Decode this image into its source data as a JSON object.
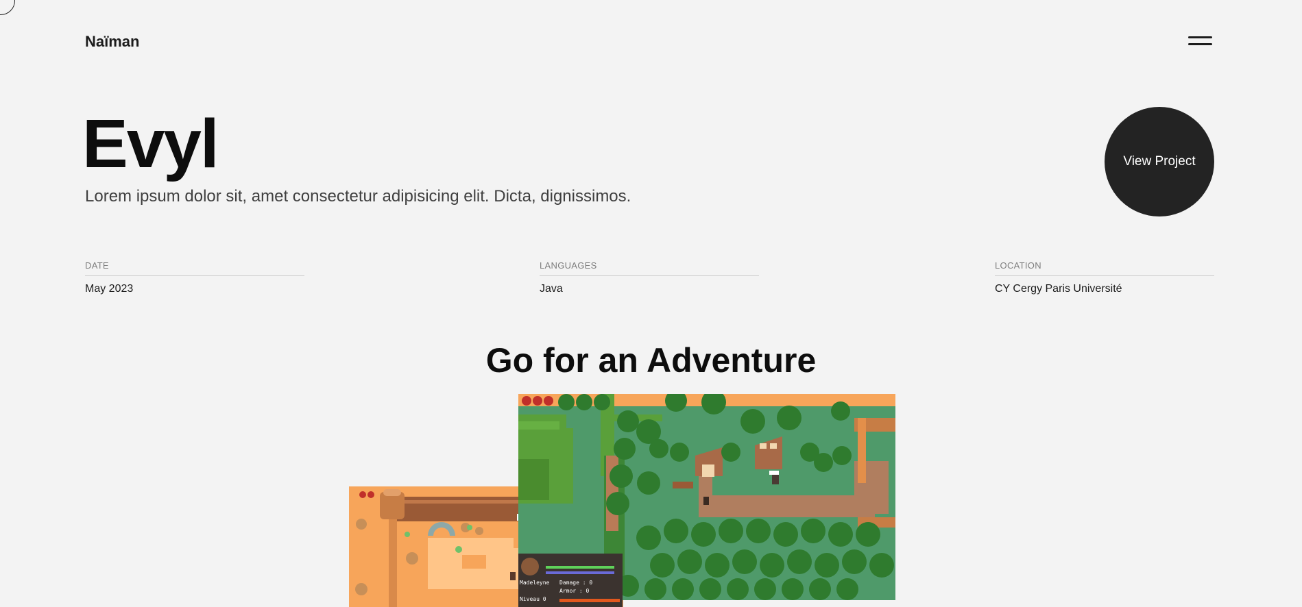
{
  "header": {
    "brand": "Naïman",
    "menu_icon": "hamburger-icon"
  },
  "hero": {
    "title": "Evyl",
    "subtitle": "Lorem ipsum dolor sit, amet consectetur adipisicing elit. Dicta, dignissimos.",
    "cta_label": "View Project"
  },
  "meta": [
    {
      "label": "DATE",
      "value": "May 2023"
    },
    {
      "label": "LANGUAGES",
      "value": "Java"
    },
    {
      "label": "LOCATION",
      "value": "CY Cergy Paris Université"
    }
  ],
  "section": {
    "heading": "Go for an Adventure"
  },
  "screenshots": {
    "desert": {
      "hud_name": "Madeleyne",
      "hud_damage": "Damage : 0",
      "hud_armor": "Armor : 0",
      "hud_level": "Niveau 0"
    }
  },
  "colors": {
    "background": "#f3f3f3",
    "cta_background": "#232323",
    "grass": "#4f9a6a",
    "sand": "#f7a55a"
  }
}
